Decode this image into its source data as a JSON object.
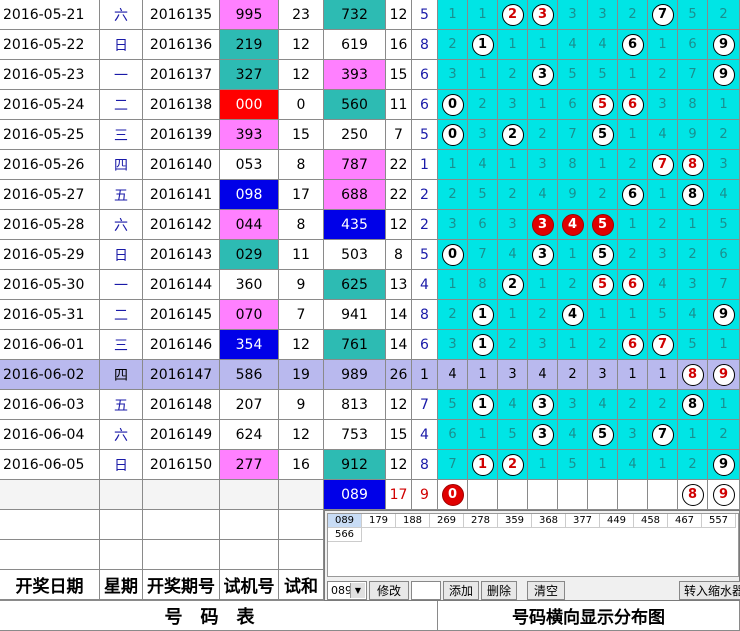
{
  "rows": [
    {
      "date": "2016-05-21",
      "week": "六",
      "issue": "2016135",
      "test": "995",
      "test_style": "pink",
      "sum": "23",
      "win": "732",
      "win_style": "teal",
      "span": "12",
      "small": "5",
      "dist": [
        "1",
        "1",
        "2",
        "3",
        "3",
        "3",
        "2",
        "7",
        "5",
        "2"
      ],
      "balls": {
        "2": "r",
        "3": "r",
        "7": "b"
      }
    },
    {
      "date": "2016-05-22",
      "week": "日",
      "issue": "2016136",
      "test": "219",
      "test_style": "teal",
      "sum": "12",
      "win": "619",
      "win_style": "",
      "span": "16",
      "small": "8",
      "dist": [
        "2",
        "1",
        "1",
        "1",
        "4",
        "4",
        "6",
        "1",
        "6",
        "9"
      ],
      "balls": {
        "1": "b",
        "6": "b",
        "9": "b"
      }
    },
    {
      "date": "2016-05-23",
      "week": "一",
      "issue": "2016137",
      "test": "327",
      "test_style": "teal",
      "sum": "12",
      "win": "393",
      "win_style": "pink",
      "span": "15",
      "small": "6",
      "dist": [
        "3",
        "1",
        "2",
        "3",
        "5",
        "5",
        "1",
        "2",
        "7",
        "9"
      ],
      "balls": {
        "3": "b",
        "9": "b"
      }
    },
    {
      "date": "2016-05-24",
      "week": "二",
      "issue": "2016138",
      "test": "000",
      "test_style": "red",
      "sum": "0",
      "win": "560",
      "win_style": "teal",
      "span": "11",
      "small": "6",
      "dist": [
        "0",
        "2",
        "3",
        "1",
        "6",
        "5",
        "6",
        "3",
        "8",
        "1"
      ],
      "balls": {
        "0": "b",
        "5": "r",
        "6": "r"
      }
    },
    {
      "date": "2016-05-25",
      "week": "三",
      "issue": "2016139",
      "test": "393",
      "test_style": "pink",
      "sum": "15",
      "win": "250",
      "win_style": "",
      "span": "7",
      "small": "5",
      "dist": [
        "0",
        "3",
        "2",
        "2",
        "7",
        "5",
        "1",
        "4",
        "9",
        "2"
      ],
      "balls": {
        "0": "b",
        "2": "b",
        "5": "b"
      }
    },
    {
      "date": "2016-05-26",
      "week": "四",
      "issue": "2016140",
      "test": "053",
      "test_style": "",
      "sum": "8",
      "win": "787",
      "win_style": "pink",
      "span": "22",
      "small": "1",
      "dist": [
        "1",
        "4",
        "1",
        "3",
        "8",
        "1",
        "2",
        "7",
        "8",
        "3"
      ],
      "balls": {
        "7": "r",
        "8": "r"
      }
    },
    {
      "date": "2016-05-27",
      "week": "五",
      "issue": "2016141",
      "test": "098",
      "test_style": "blue",
      "sum": "17",
      "win": "688",
      "win_style": "pink",
      "span": "22",
      "small": "2",
      "dist": [
        "2",
        "5",
        "2",
        "4",
        "9",
        "2",
        "6",
        "1",
        "8",
        "4"
      ],
      "balls": {
        "6": "b",
        "8": "b"
      }
    },
    {
      "date": "2016-05-28",
      "week": "六",
      "issue": "2016142",
      "test": "044",
      "test_style": "pink",
      "sum": "8",
      "win": "435",
      "win_style": "blue",
      "span": "12",
      "small": "2",
      "dist": [
        "3",
        "6",
        "3",
        "3",
        "4",
        "5",
        "1",
        "2",
        "1",
        "5"
      ],
      "balls": {
        "3": "rf",
        "4": "rf",
        "5": "rf"
      }
    },
    {
      "date": "2016-05-29",
      "week": "日",
      "issue": "2016143",
      "test": "029",
      "test_style": "teal",
      "sum": "11",
      "win": "503",
      "win_style": "",
      "span": "8",
      "small": "5",
      "dist": [
        "0",
        "7",
        "4",
        "3",
        "1",
        "5",
        "2",
        "3",
        "2",
        "6"
      ],
      "balls": {
        "0": "b",
        "3": "b",
        "5": "b"
      }
    },
    {
      "date": "2016-05-30",
      "week": "一",
      "issue": "2016144",
      "test": "360",
      "test_style": "",
      "sum": "9",
      "win": "625",
      "win_style": "teal",
      "span": "13",
      "small": "4",
      "dist": [
        "1",
        "8",
        "2",
        "1",
        "2",
        "5",
        "6",
        "4",
        "3",
        "7"
      ],
      "balls": {
        "2": "b",
        "5": "r",
        "6": "r"
      }
    },
    {
      "date": "2016-05-31",
      "week": "二",
      "issue": "2016145",
      "test": "070",
      "test_style": "pink",
      "sum": "7",
      "win": "941",
      "win_style": "",
      "span": "14",
      "small": "8",
      "dist": [
        "2",
        "1",
        "1",
        "2",
        "4",
        "1",
        "1",
        "5",
        "4",
        "9"
      ],
      "balls": {
        "1": "b",
        "4": "b",
        "9": "b"
      }
    },
    {
      "date": "2016-06-01",
      "week": "三",
      "issue": "2016146",
      "test": "354",
      "test_style": "blue",
      "sum": "12",
      "win": "761",
      "win_style": "teal",
      "span": "14",
      "small": "6",
      "dist": [
        "3",
        "1",
        "2",
        "3",
        "1",
        "2",
        "6",
        "7",
        "5",
        "1"
      ],
      "balls": {
        "1": "b",
        "6": "r",
        "7": "r"
      }
    },
    {
      "date": "2016-06-02",
      "week": "四",
      "issue": "2016147",
      "test": "586",
      "test_style": "teal",
      "sum": "19",
      "win": "989",
      "win_style": "pink",
      "span": "26",
      "small": "1",
      "hl": true,
      "dist": [
        "4",
        "1",
        "3",
        "4",
        "2",
        "3",
        "1",
        "1",
        "8",
        "9"
      ],
      "balls": {
        "8": "r",
        "9": "r"
      }
    },
    {
      "date": "2016-06-03",
      "week": "五",
      "issue": "2016148",
      "test": "207",
      "test_style": "",
      "sum": "9",
      "win": "813",
      "win_style": "",
      "span": "12",
      "small": "7",
      "dist": [
        "5",
        "1",
        "4",
        "3",
        "3",
        "4",
        "2",
        "2",
        "8",
        "1"
      ],
      "balls": {
        "1": "b",
        "3": "b",
        "8": "b"
      }
    },
    {
      "date": "2016-06-04",
      "week": "六",
      "issue": "2016149",
      "test": "624",
      "test_style": "",
      "sum": "12",
      "win": "753",
      "win_style": "",
      "span": "15",
      "small": "4",
      "dist": [
        "6",
        "1",
        "5",
        "3",
        "4",
        "5",
        "3",
        "7",
        "1",
        "2"
      ],
      "balls": {
        "3": "b",
        "5": "b",
        "7": "b"
      }
    },
    {
      "date": "2016-06-05",
      "week": "日",
      "issue": "2016150",
      "test": "277",
      "test_style": "pink",
      "sum": "16",
      "win": "912",
      "win_style": "teal",
      "span": "12",
      "small": "8",
      "dist": [
        "7",
        "1",
        "2",
        "1",
        "5",
        "1",
        "4",
        "1",
        "2",
        "9"
      ],
      "balls": {
        "1": "r",
        "2": "r",
        "9": "b"
      }
    }
  ],
  "predict": {
    "win": "089",
    "span": "17",
    "small": "9",
    "dist": [
      "0",
      "",
      "",
      "",
      "",
      "",
      "",
      "",
      "8",
      "9"
    ],
    "balls": {
      "0": "rf",
      "8": "r",
      "9": "r"
    }
  },
  "headers": {
    "date": "开奖日期",
    "week": "星期",
    "issue": "开奖期号",
    "test": "试机号",
    "sum": "试和"
  },
  "footer": {
    "left": "号码表",
    "right": "号码横向显示分布图"
  },
  "panel": {
    "numbers_row1": [
      "089",
      "179",
      "188",
      "269",
      "278",
      "359",
      "368",
      "377",
      "449",
      "458",
      "467",
      "557"
    ],
    "numbers_row2": [
      "566"
    ],
    "select_value": "089",
    "modify_label": "修改",
    "add_label": "添加",
    "delete_label": "删除",
    "clear_label": "清空",
    "transfer_label": "转入缩水器"
  }
}
